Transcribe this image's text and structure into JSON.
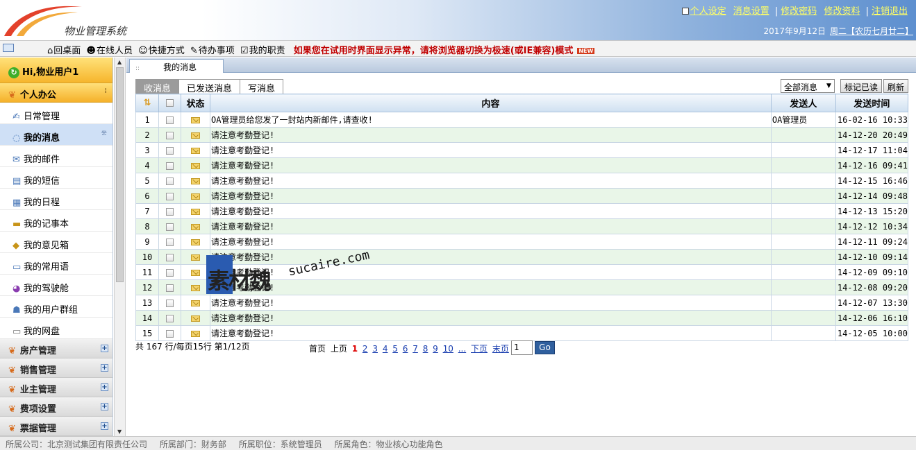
{
  "app": {
    "title": "物业管理系统",
    "brand_colors": {
      "header_blue": "#5d8fcf",
      "accent_orange": "#f5b12a",
      "row_green": "#e9f6e8"
    }
  },
  "top_links": [
    "个人设定",
    "消息设置",
    "修改密码",
    "修改资料",
    "注销退出"
  ],
  "date": {
    "date_text": "2017年9月12日",
    "weekday_lunar": "周二【农历七月廿二】"
  },
  "toolbar": {
    "items": [
      {
        "label": "回桌面",
        "icon": "home-icon"
      },
      {
        "label": "在线人员",
        "icon": "online-users-icon"
      },
      {
        "label": "快捷方式",
        "icon": "smiley-icon"
      },
      {
        "label": "待办事项",
        "icon": "todo-icon"
      },
      {
        "label": "我的职责",
        "icon": "duty-icon"
      }
    ],
    "warning": "如果您在试用时界面显示异常，请将浏览器切换为极速(或IE兼容)模式",
    "new_badge": "NEW"
  },
  "sidebar": {
    "greeting": "Hi,物业用户1",
    "active_section": "个人办公",
    "items": [
      {
        "label": "日常管理",
        "icon": "daily-icon"
      },
      {
        "label": "我的消息",
        "icon": "message-icon",
        "selected": true
      },
      {
        "label": "我的邮件",
        "icon": "mail-icon"
      },
      {
        "label": "我的短信",
        "icon": "sms-icon"
      },
      {
        "label": "我的日程",
        "icon": "calendar-icon"
      },
      {
        "label": "我的记事本",
        "icon": "notebook-icon"
      },
      {
        "label": "我的意见箱",
        "icon": "suggestion-icon"
      },
      {
        "label": "我的常用语",
        "icon": "phrase-icon"
      },
      {
        "label": "我的驾驶舱",
        "icon": "dashboard-icon"
      },
      {
        "label": "我的用户群组",
        "icon": "group-icon"
      },
      {
        "label": "我的网盘",
        "icon": "disk-icon"
      }
    ],
    "collapsed_sections": [
      "房产管理",
      "销售管理",
      "业主管理",
      "费项设置",
      "票据管理"
    ]
  },
  "main": {
    "window_tab": "我的消息",
    "msg_tabs": [
      "收消息",
      "已发送消息",
      "写消息"
    ],
    "filter": {
      "selected": "全部消息"
    },
    "buttons": {
      "mark_read": "标记已读",
      "refresh": "刷新"
    },
    "columns": [
      "状态",
      "内容",
      "发送人",
      "发送时间"
    ],
    "rows": [
      {
        "no": "1",
        "content": "OA管理员给您发了一封站内新邮件,请查收!",
        "sender": "OA管理员",
        "time": "16-02-16 10:33"
      },
      {
        "no": "2",
        "content": "请注意考勤登记!",
        "sender": "",
        "time": "14-12-20 20:49"
      },
      {
        "no": "3",
        "content": "请注意考勤登记!",
        "sender": "",
        "time": "14-12-17 11:04"
      },
      {
        "no": "4",
        "content": "请注意考勤登记!",
        "sender": "",
        "time": "14-12-16 09:41"
      },
      {
        "no": "5",
        "content": "请注意考勤登记!",
        "sender": "",
        "time": "14-12-15 16:46"
      },
      {
        "no": "6",
        "content": "请注意考勤登记!",
        "sender": "",
        "time": "14-12-14 09:48"
      },
      {
        "no": "7",
        "content": "请注意考勤登记!",
        "sender": "",
        "time": "14-12-13 15:20"
      },
      {
        "no": "8",
        "content": "请注意考勤登记!",
        "sender": "",
        "time": "14-12-12 10:34"
      },
      {
        "no": "9",
        "content": "请注意考勤登记!",
        "sender": "",
        "time": "14-12-11 09:24"
      },
      {
        "no": "10",
        "content": "请注意考勤登记!",
        "sender": "",
        "time": "14-12-10 09:14"
      },
      {
        "no": "11",
        "content": "请注意考勤登记!",
        "sender": "",
        "time": "14-12-09 09:10"
      },
      {
        "no": "12",
        "content": "请注意考勤登记!",
        "sender": "",
        "time": "14-12-08 09:20"
      },
      {
        "no": "13",
        "content": "请注意考勤登记!",
        "sender": "",
        "time": "14-12-07 13:30"
      },
      {
        "no": "14",
        "content": "请注意考勤登记!",
        "sender": "",
        "time": "14-12-06 16:10"
      },
      {
        "no": "15",
        "content": "请注意考勤登记!",
        "sender": "",
        "time": "14-12-05 10:00"
      }
    ],
    "pager": {
      "summary": "共 167 行/每页15行 第1/12页",
      "first": "首页",
      "prev": "上页",
      "pages": [
        "1",
        "2",
        "3",
        "4",
        "5",
        "6",
        "7",
        "8",
        "9",
        "10"
      ],
      "current_page": "1",
      "more": "...",
      "next": "下页",
      "last": "末页",
      "goto_value": "1",
      "go_label": "Go"
    }
  },
  "watermark": {
    "cn": "素材魏",
    "en": "sucaire.com"
  },
  "footer": {
    "company": "所属公司：北京测试集团有限责任公司",
    "dept": "所属部门：财务部",
    "position": "所属职位：系统管理员",
    "role": "所属角色：物业核心功能角色"
  }
}
